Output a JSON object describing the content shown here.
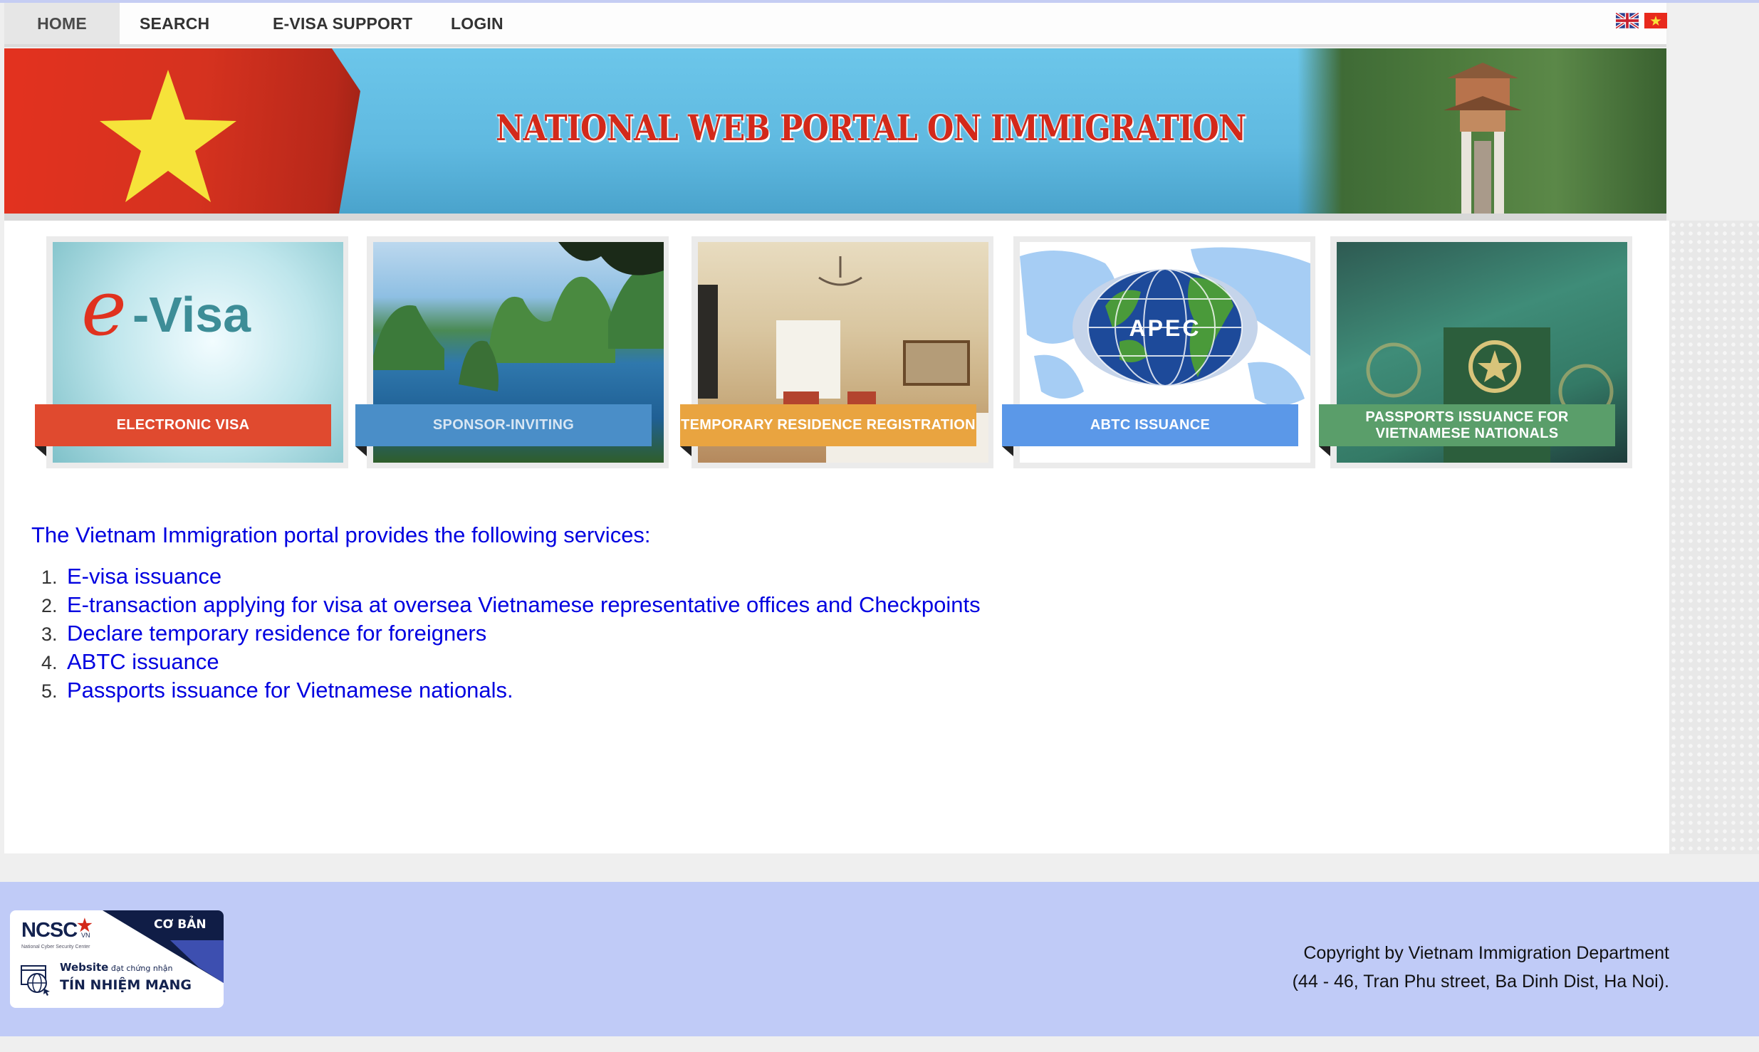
{
  "nav": {
    "items": [
      {
        "label": "HOME",
        "active": true
      },
      {
        "label": "SEARCH",
        "active": false
      },
      {
        "label": "E-VISA SUPPORT",
        "active": false
      },
      {
        "label": "LOGIN",
        "active": false
      }
    ],
    "languages": [
      {
        "name": "English",
        "icon": "uk-flag-icon"
      },
      {
        "name": "Tiếng Việt",
        "icon": "vietnam-flag-icon"
      }
    ]
  },
  "banner": {
    "title": "NATIONAL WEB PORTAL ON IMMIGRATION"
  },
  "tiles": [
    {
      "label": "ELECTRONIC VISA",
      "color": "#e04a2f",
      "image": "e-Visa"
    },
    {
      "label": "SPONSOR-INVITING",
      "color": "#4a8ec8",
      "image": "halong-bay"
    },
    {
      "label": "TEMPORARY RESIDENCE REGISTRATION",
      "color": "#e9a440",
      "image": "hotel-room"
    },
    {
      "label": "ABTC ISSUANCE",
      "color": "#5b98e8",
      "image": "APEC"
    },
    {
      "label": "PASSPORTS ISSUANCE FOR VIETNAMESE NATIONALS",
      "color": "#5a9e6a",
      "image": "passports"
    }
  ],
  "content": {
    "intro": "The Vietnam Immigration portal provides the following services:",
    "services": [
      {
        "num": "1.",
        "label": "E-visa issuance"
      },
      {
        "num": "2.",
        "label": "E-transaction applying for visa at oversea Vietnamese representative offices and Checkpoints"
      },
      {
        "num": "3.",
        "label": "Declare temporary residence for foreigners"
      },
      {
        "num": "4.",
        "label": "ABTC issuance"
      },
      {
        "num": "5.",
        "label": "Passports issuance for Vietnamese nationals."
      }
    ]
  },
  "footer": {
    "badge": {
      "org": "NCSC",
      "country": "VN",
      "org_full": "National Cyber Security Center",
      "level": "CƠ BẢN",
      "line1_bold": "Website",
      "line1_rest": " đạt chứng nhận",
      "line2": "TÍN NHIỆM MẠNG"
    },
    "copyright_line1": "Copyright by Vietnam Immigration Department",
    "copyright_line2": "(44 - 46, Tran Phu street, Ba Dinh Dist, Ha Noi)."
  },
  "colors": {
    "link": "#0000e0",
    "footer_bg": "#c0cbf7",
    "nav_active_bg": "#e6e6e6"
  }
}
